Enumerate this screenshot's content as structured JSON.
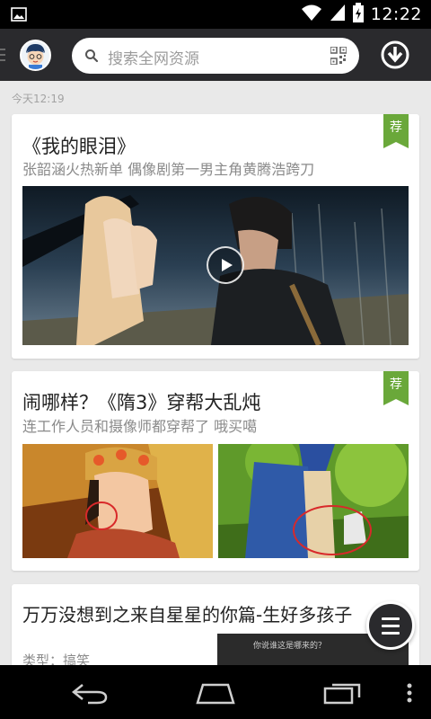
{
  "status_bar": {
    "time": "12:22",
    "icons": [
      "gallery-icon",
      "wifi-icon",
      "signal-icon",
      "battery-icon"
    ]
  },
  "app_bar": {
    "search_placeholder": "搜索全网资源",
    "icons": [
      "menu-icon",
      "avatar",
      "search-icon",
      "qr-code-icon",
      "download-icon"
    ],
    "accent_color": "#2a2a2d"
  },
  "feed": {
    "timestamp": "今天12:19",
    "cards": [
      {
        "title": "《我的眼泪》",
        "subtitle": "张韶涵火热新单 偶像剧第一男主角黄腾浩跨刀",
        "badge": "荐",
        "media": "video"
      },
      {
        "title": "闹哪样？《隋3》穿帮大乱炖",
        "subtitle": "连工作人员和摄像师都穿帮了 哦买噶",
        "badge": "荐",
        "media": "two-images"
      },
      {
        "title": "万万没想到之来自星星的你篇-生好多孩子",
        "meta": "类型：搞笑",
        "thumb_caption": "你说谁这是哪来的？"
      }
    ],
    "badge_color": "#6aa83a"
  },
  "nav_bar": {
    "icons": [
      "back-icon",
      "home-icon",
      "recent-apps-icon",
      "overflow-menu-icon"
    ]
  }
}
